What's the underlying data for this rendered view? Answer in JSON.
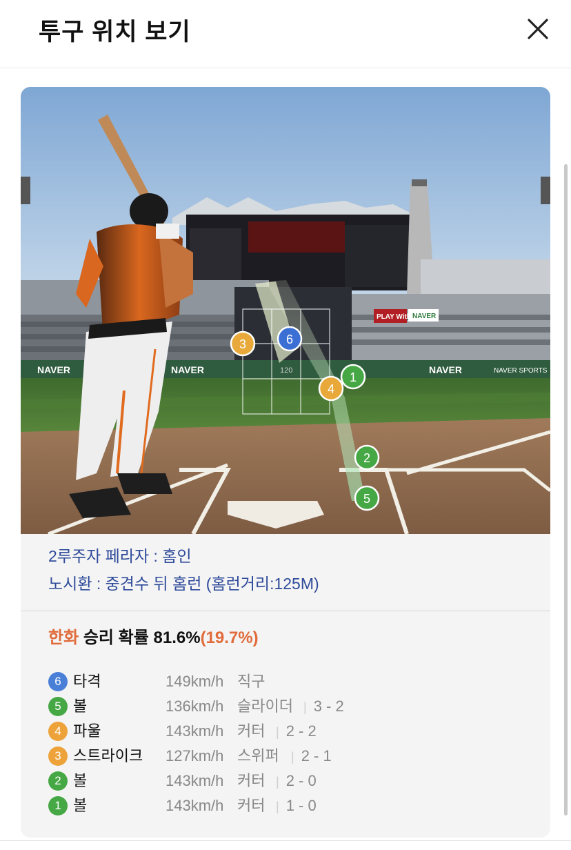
{
  "header": {
    "title": "투구 위치 보기",
    "close_icon": "close-icon"
  },
  "scene": {
    "description_icon": "baseball-batter-view",
    "board_texts": {
      "naver_left": "NAVER",
      "naver_center": "NAVER",
      "naver_right": "NAVER",
      "naver_sports": "NAVER SPORTS",
      "speed_display": "120",
      "stadium_ad": "PLAY With",
      "naver_top": "NAVER"
    },
    "markers": [
      {
        "num": "6",
        "color": "#3b6fd4"
      },
      {
        "num": "3",
        "color": "#e8a93a"
      },
      {
        "num": "1",
        "color": "#46a845"
      },
      {
        "num": "4",
        "color": "#e8a93a"
      },
      {
        "num": "2",
        "color": "#46a845"
      },
      {
        "num": "5",
        "color": "#46a845"
      }
    ]
  },
  "events": [
    "2루주자 페라자 : 홈인",
    "노시환 : 중견수 뒤 홈런 (홈런거리:125M)"
  ],
  "win_probability": {
    "team": "한화",
    "label": " 승리 확률 ",
    "value": "81.6%",
    "delta": "(19.7%)"
  },
  "pitches": [
    {
      "num": "6",
      "color": "#4a7fd8",
      "result": "타격",
      "speed": "149km/h",
      "type": "직구",
      "count": ""
    },
    {
      "num": "5",
      "color": "#46a845",
      "result": "볼",
      "speed": "136km/h",
      "type": "슬라이더",
      "count": "3 - 2"
    },
    {
      "num": "4",
      "color": "#eda23a",
      "result": "파울",
      "speed": "143km/h",
      "type": "커터",
      "count": "2 - 2"
    },
    {
      "num": "3",
      "color": "#eda23a",
      "result": "스트라이크",
      "speed": "127km/h",
      "type": "스위퍼",
      "count": "2 - 1"
    },
    {
      "num": "2",
      "color": "#46a845",
      "result": "볼",
      "speed": "143km/h",
      "type": "커터",
      "count": "2 - 0"
    },
    {
      "num": "1",
      "color": "#46a845",
      "result": "볼",
      "speed": "143km/h",
      "type": "커터",
      "count": "1 - 0"
    }
  ]
}
